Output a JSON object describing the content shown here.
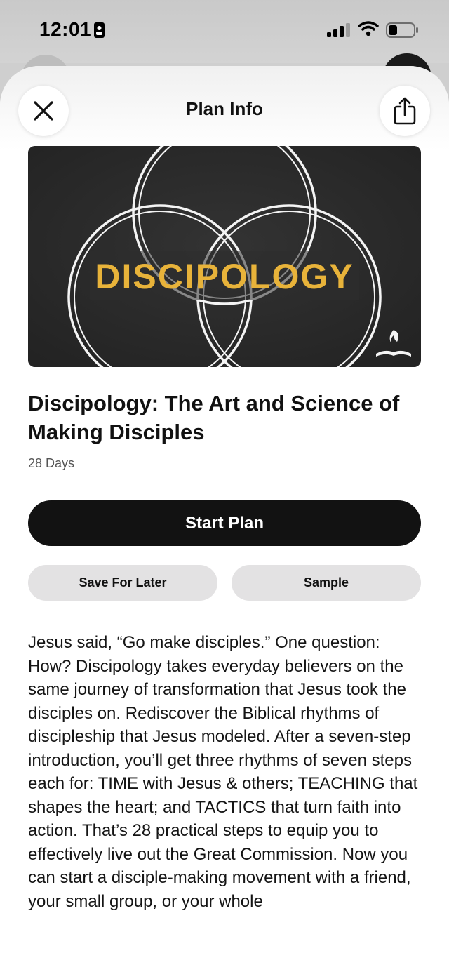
{
  "status_bar": {
    "time": "12:01"
  },
  "header": {
    "title": "Plan Info",
    "close_icon": "close-icon",
    "share_icon": "share-icon"
  },
  "plan": {
    "image_text": "DISCIPOLOGY",
    "title": "Discipology: The Art and Science of Making Disciples",
    "duration": "28 Days",
    "description": "Jesus said, “Go make disciples.” One question: How? Discipology takes everyday believers on the same journey of transformation that Jesus took the disciples on. Rediscover the Biblical rhythms of discipleship that Jesus modeled. After a seven-step introduction, you’ll get three rhythms of seven steps each for: TIME with Jesus & others; TEACHING that shapes the heart; and TACTICS that turn faith into action. That’s 28 practical steps to equip you to effectively live out the Great Commission. Now you can start a disciple-making movement with a friend, your small group, or your whole"
  },
  "actions": {
    "start_label": "Start Plan",
    "save_label": "Save For Later",
    "sample_label": "Sample"
  },
  "colors": {
    "primary_button": "#121212",
    "secondary_button": "#e3e2e3",
    "image_text": "#e8b33a",
    "image_background": "#2b2b2b"
  }
}
